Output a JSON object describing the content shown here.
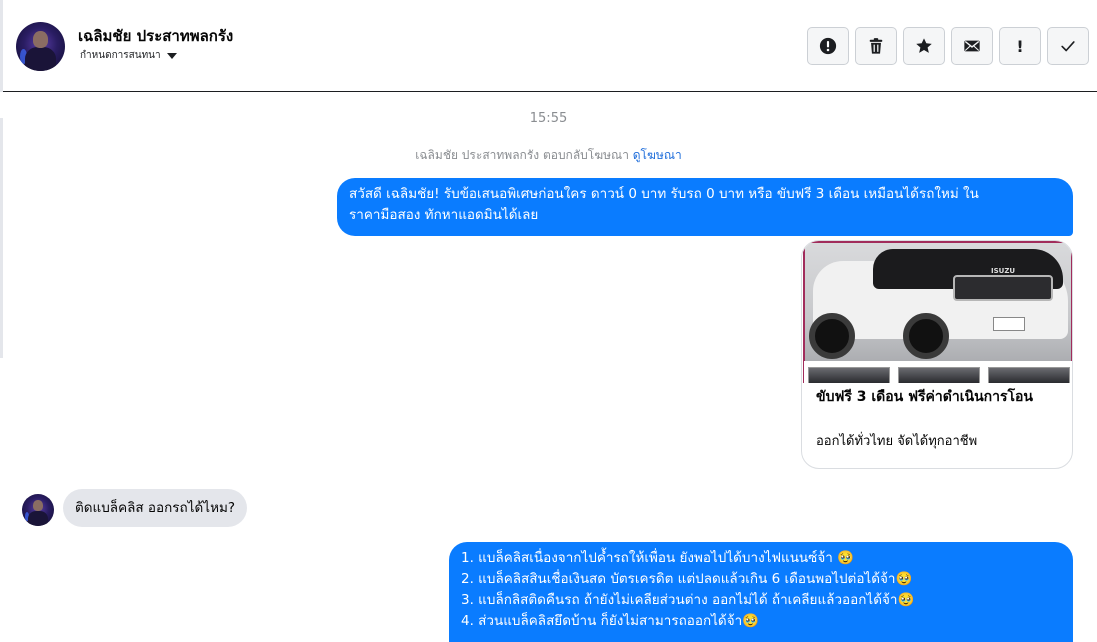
{
  "header": {
    "contact_name": "เฉลิมชัย ประสาทพลกรัง",
    "conversation_label": "กำหนดการสนทนา"
  },
  "toolbar": {
    "buttons": [
      {
        "name": "report",
        "icon": "exclamation-circle-icon"
      },
      {
        "name": "delete",
        "icon": "trash-icon"
      },
      {
        "name": "star",
        "icon": "star-icon"
      },
      {
        "name": "mark-unread",
        "icon": "envelope-icon"
      },
      {
        "name": "important",
        "icon": "exclamation-icon",
        "glyph": "!"
      },
      {
        "name": "done",
        "icon": "checkmark-icon"
      }
    ]
  },
  "chat": {
    "timestamp": "15:55",
    "ad_notice": {
      "text": "เฉลิมชัย ประสาทพลกรัง ตอบกลับโฆษณา",
      "link": "ดูโฆษณา"
    },
    "outgoing_message_1": {
      "line1": "สวัสดี เฉลิมชัย! รับข้อเสนอพิเศษก่อนใคร ดาวน์ 0 บาท รับรถ 0 บาท หรือ ขับฟรี 3 เดือน เหมือนได้รถใหม่ ใน",
      "line2": "ราคามือสอง ทักหาแอดมินได้เลย"
    },
    "ad_card": {
      "title": "ขับฟรี 3 เดือน ฟรีค่าดำเนินการโอน",
      "description": "ออกได้ทั่วไทย จัดได้ทุกอาชีพ",
      "image_brand": "ISUZU"
    },
    "incoming_message": "ติดแบล็คลิส ออกรถได้ไหม?",
    "outgoing_message_2": {
      "lines": [
        "1. แบล็คลิสเนื่องจากไปค้ำรถให้เพื่อน ยังพอไปได้บางไฟแนนซ์จ้า 🥹",
        "2. แบล็คลิสสินเชื่อเงินสด บัตรเครดิต แต่ปลดแล้วเกิน 6 เดือนพอไปต่อได้จ้า🥹",
        "3. แบล็กลิสติดคืนรถ ถ้ายังไม่เคลียส่วนต่าง ออกไม่ได้ ถ้าเคลียแล้วออกได้จ้า🥹",
        "4. ส่วนแบล็คลิสยึดบ้าน ก็ยังไม่สามารถออกได้จ้า🥹"
      ]
    }
  },
  "colors": {
    "outgoing_bubble": "#0a7cff",
    "incoming_bubble": "#e4e6eb",
    "link": "#216fdb",
    "muted_text": "#8a8d91"
  }
}
